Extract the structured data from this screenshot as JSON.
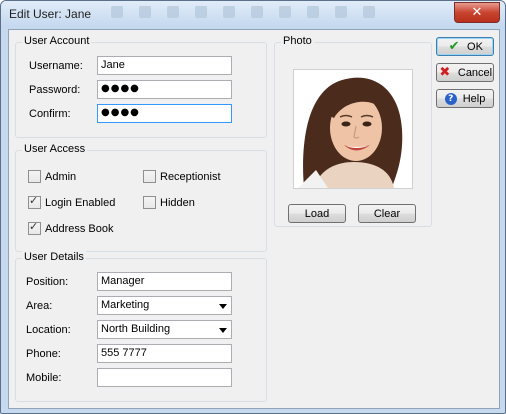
{
  "window": {
    "title": "Edit User: Jane"
  },
  "account": {
    "group_label": "User Account",
    "username": {
      "label": "Username:",
      "value": "Jane"
    },
    "password": {
      "label": "Password:",
      "value": "●●●●"
    },
    "confirm": {
      "label": "Confirm:",
      "value": "●●●●"
    }
  },
  "access": {
    "group_label": "User Access",
    "admin": {
      "label": "Admin",
      "checked": false
    },
    "receptionist": {
      "label": "Receptionist",
      "checked": false
    },
    "login_enabled": {
      "label": "Login Enabled",
      "checked": true
    },
    "hidden": {
      "label": "Hidden",
      "checked": false
    },
    "address_book": {
      "label": "Address Book",
      "checked": true
    },
    "check_glyph": "✓"
  },
  "details": {
    "group_label": "User Details",
    "position": {
      "label": "Position:",
      "value": "Manager"
    },
    "area": {
      "label": "Area:",
      "value": "Marketing"
    },
    "location": {
      "label": "Location:",
      "value": "North Building"
    },
    "phone": {
      "label": "Phone:",
      "value": "555 7777"
    },
    "mobile": {
      "label": "Mobile:",
      "value": ""
    }
  },
  "photo": {
    "group_label": "Photo",
    "load_label": "Load",
    "clear_label": "Clear"
  },
  "buttons": {
    "ok_label": "OK",
    "cancel_label": "Cancel",
    "help_label": "Help",
    "ok_icon": "✔",
    "cancel_icon": "✖",
    "help_icon": "?"
  },
  "colors": {
    "title_bar": "#c4d8ef",
    "close_button": "#c8442f",
    "dialog_background": "#f0f0f0",
    "focus_border": "#3399ff"
  }
}
